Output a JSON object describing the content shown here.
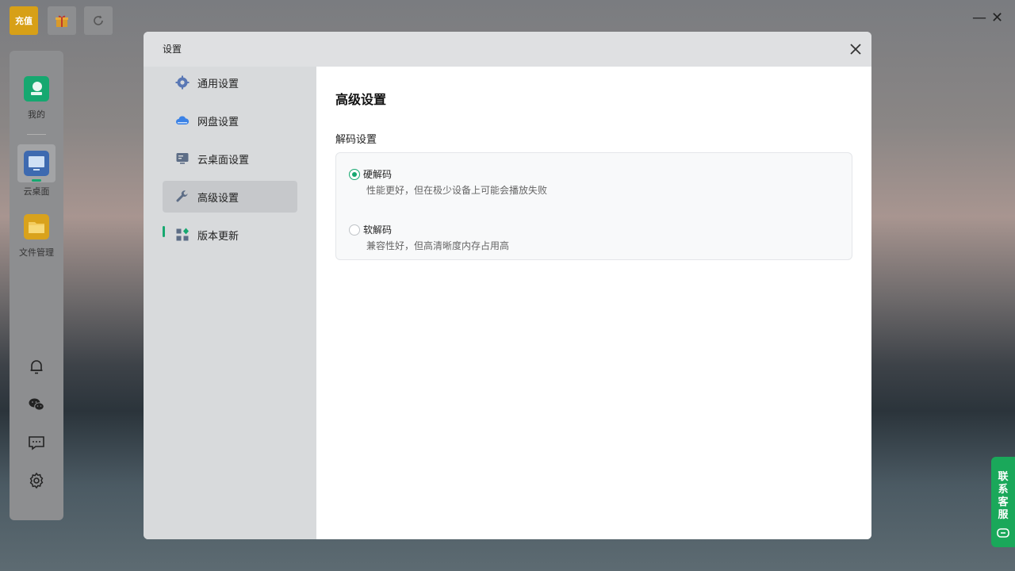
{
  "toolbar": {
    "recharge_label": "充值",
    "gift_icon": "gift-icon",
    "refresh_icon": "refresh-icon",
    "minimize_glyph": "—",
    "close_glyph": "✕"
  },
  "dock": {
    "items": [
      {
        "label": "我的",
        "icon": "user-profile-icon"
      },
      {
        "label": "云桌面",
        "icon": "monitor-icon"
      },
      {
        "label": "文件管理",
        "icon": "folder-icon"
      }
    ],
    "tools": [
      "bell-icon",
      "wechat-icon",
      "feedback-icon",
      "settings-icon"
    ]
  },
  "modal": {
    "title": "设置",
    "nav": [
      {
        "label": "通用设置",
        "icon": "gear-icon"
      },
      {
        "label": "网盘设置",
        "icon": "cloud-icon"
      },
      {
        "label": "云桌面设置",
        "icon": "desktop-icon"
      },
      {
        "label": "高级设置",
        "icon": "wrench-icon",
        "active": true
      },
      {
        "label": "版本更新",
        "icon": "apps-icon"
      }
    ],
    "main": {
      "title": "高级设置",
      "section_title": "解码设置",
      "options": [
        {
          "label": "硬解码",
          "desc": "性能更好，但在极少设备上可能会播放失败",
          "selected": true
        },
        {
          "label": "软解码",
          "desc": "兼容性好，但高清晰度内存占用高",
          "selected": false
        }
      ]
    }
  },
  "contact": {
    "label": "联系客服",
    "icon": "chat-bubble-icon"
  },
  "colors": {
    "accent": "#16a870",
    "recharge": "#d7a017",
    "contact": "#1aa85a"
  }
}
